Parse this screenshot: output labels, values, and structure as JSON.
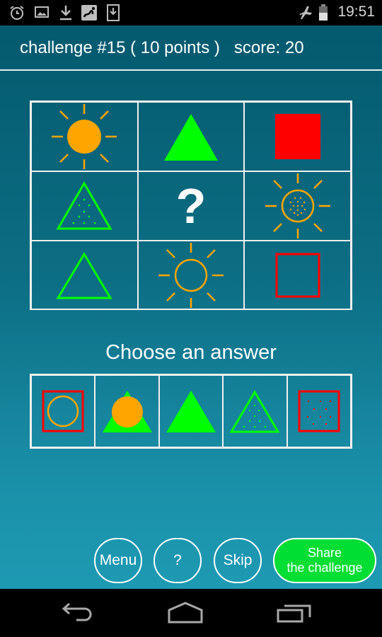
{
  "status_bar": {
    "time": "19:51",
    "left_icons": [
      "alarm-clock-icon",
      "image-icon",
      "download-icon",
      "app-notification-icon",
      "download-box-icon"
    ],
    "right_icons": [
      "airplane-mode-icon",
      "battery-icon"
    ]
  },
  "header": {
    "title": "challenge #15 ( 10 points )   score: 20",
    "challenge_number": 15,
    "points": 10,
    "score": 20
  },
  "puzzle": {
    "cells": [
      {
        "shape": "sun-filled",
        "color": "#ffa500"
      },
      {
        "shape": "triangle-filled",
        "color": "#00ff00"
      },
      {
        "shape": "square-filled",
        "color": "#ff0000"
      },
      {
        "shape": "triangle-dotted",
        "color": "#00ff00"
      },
      {
        "shape": "question-mark",
        "text": "?"
      },
      {
        "shape": "sun-dotted",
        "color": "#ffa500"
      },
      {
        "shape": "triangle-outline",
        "color": "#00ff00"
      },
      {
        "shape": "sun-outline",
        "color": "#ffa500"
      },
      {
        "shape": "square-outline",
        "color": "#ff0000"
      }
    ]
  },
  "answers": {
    "label": "Choose an answer",
    "options": [
      {
        "shape": "circle-in-square-outline",
        "colors": [
          "#ff0000",
          "#ffa500"
        ]
      },
      {
        "shape": "circle-on-triangle-filled",
        "colors": [
          "#00ff00",
          "#ffa500"
        ]
      },
      {
        "shape": "triangle-filled",
        "colors": [
          "#00ff00"
        ]
      },
      {
        "shape": "triangle-dotted",
        "colors": [
          "#00ff00"
        ]
      },
      {
        "shape": "square-dotted",
        "colors": [
          "#ff0000"
        ]
      }
    ]
  },
  "buttons": {
    "menu": "Menu",
    "help": "?",
    "skip": "Skip",
    "share_line1": "Share",
    "share_line2": "the challenge"
  },
  "nav_bar": {
    "icons": [
      "back-icon",
      "home-icon",
      "recent-apps-icon"
    ]
  },
  "colors": {
    "orange": "#ffa500",
    "green": "#00ff00",
    "red": "#ff0000",
    "share_button": "#00dd33"
  }
}
